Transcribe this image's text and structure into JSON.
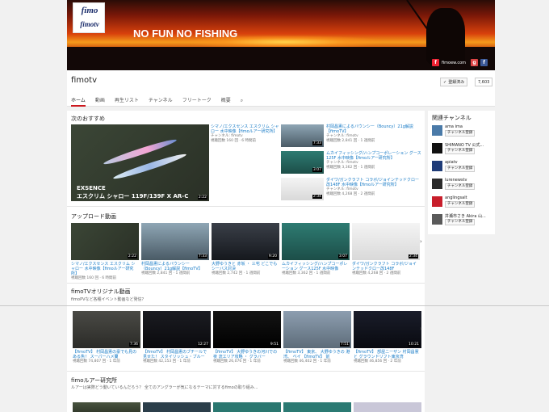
{
  "banner": {
    "slogan": "NO FUN NO FISHING",
    "logo_line1": "fimo",
    "logo_line2": "fimotv",
    "site_link": "fimoew.com"
  },
  "channel": {
    "name": "fimotv",
    "subscribe_label": "登録済み",
    "sub_count": "7,603"
  },
  "tabs": [
    "ホーム",
    "動画",
    "再生リスト",
    "チャンネル",
    "フリートーク",
    "概要"
  ],
  "featured": {
    "section_title": "次のおすすめ",
    "overlay1": "EXSENCE",
    "overlay2": "エスクリム シャロー 119F/139F X AR-C",
    "duration": "2:22",
    "title": "シマノ/エクスセンス エスクリム シャロー 水中映像【fimoルアー研究所】",
    "channel": "チャンネル: fimotv",
    "meta": "視聴回数 160 回 · 6 時間前"
  },
  "reco": [
    {
      "title": "村岡昌憲によるバウンシー（Bouncy）21g解説【fimoTV】",
      "channel": "チャンネル: fimotv",
      "meta": "視聴回数 2,841 回 · 1 週間前",
      "duration": "7:33"
    },
    {
      "title": "ムカイフィッシング/ハンプコーポレーション グース125F 水中映像【fimoルアー研究所】",
      "channel": "チャンネル: fimotv",
      "meta": "視聴回数 3,362 回 · 1 週間前",
      "duration": "3:07"
    },
    {
      "title": "ダイワ/ガンクラフト コラボ/ジョインテッドクロー改148F 水中映像【fimoルアー研究所】",
      "channel": "チャンネル: fimotv",
      "meta": "視聴回数 4,268 回 · 2 週間前",
      "duration": "2:34"
    }
  ],
  "uploads": {
    "section_title": "アップロード動画",
    "items": [
      {
        "title": "シマノ/エクスセンス エスクリム シャロー 水中映像【fimoルアー研究所】",
        "meta": "視聴回数 160 回 · 6 時間前",
        "duration": "2:22"
      },
      {
        "title": "村岡昌憲によるバウンシー（Bouncy）21g解説【fimoTV】",
        "meta": "視聴回数 2,841 回 · 1 週間前",
        "duration": "7:33"
      },
      {
        "title": "大野ゆうきと 赤坂 ・ 三宅 どこでもシーバス対決",
        "meta": "視聴回数 2,742 回 · 1 週間前",
        "duration": "9:20"
      },
      {
        "title": "ムカイフィッシング/ハンプコーポレーション グース125F 水中映像",
        "meta": "視聴回数 3,362 回 · 1 週間前",
        "duration": "3:07"
      },
      {
        "title": "ダイワ/ガンクラフト コラボ/ジョインテッドクロー改148F",
        "meta": "視聴回数 4,268 回 · 2 週間前",
        "duration": "2:34"
      }
    ]
  },
  "original": {
    "section_title": "fimoTVオリジナル動画",
    "subtitle": "fimoPVなど各種イベント動画など発信？",
    "items": [
      {
        "title": "【fimoTV】 村岡昌憲の豪でも見のある魚！ スーパーハメ蘭",
        "meta": "視聴回数 74,807 回 · 1 年前",
        "duration": "7:36"
      },
      {
        "title": "【fimoTV】 村岡昌憲のブチールで見せた！ スタイリッシュ・ブルー",
        "meta": "視聴回数 42,153 回 · 1 年前",
        "duration": "12:27"
      },
      {
        "title": "【fimoTV】 大野ゆうきの河川での 夜 流エリア攻略 ・ グラバー",
        "meta": "視聴回数 26,076 回 · 1 年前",
        "duration": "9:51"
      },
      {
        "title": "【fimoTV】 東京、 大野ゆうきの 港湾、 ベイ 【fimoTV】 前",
        "meta": "視聴回数 46,402 回 · 1 年前",
        "duration": "7:51"
      },
      {
        "title": "【fimoTV】 部屋ニーザン 村岡昌憲 と グラウンドリフト東京湾",
        "meta": "視聴回数 46,856 回 · 2 年前",
        "duration": "10:21"
      }
    ]
  },
  "lure_lab": {
    "section_title": "fimoルアー研究所",
    "subtitle": "ルアーは実際どう動いているんだろう？ 全てのアングラーが気になるテーマに対するfimoの取り組み..."
  },
  "sidebar": {
    "title": "関連チャンネル",
    "subscribe_label": "チャンネル登録",
    "channels": [
      "ama ima",
      "SHIMANO TV 公式...",
      "apiatv",
      "lurenewstv",
      "anglingsalt",
      "井瀬市さき Akira 山..."
    ]
  }
}
